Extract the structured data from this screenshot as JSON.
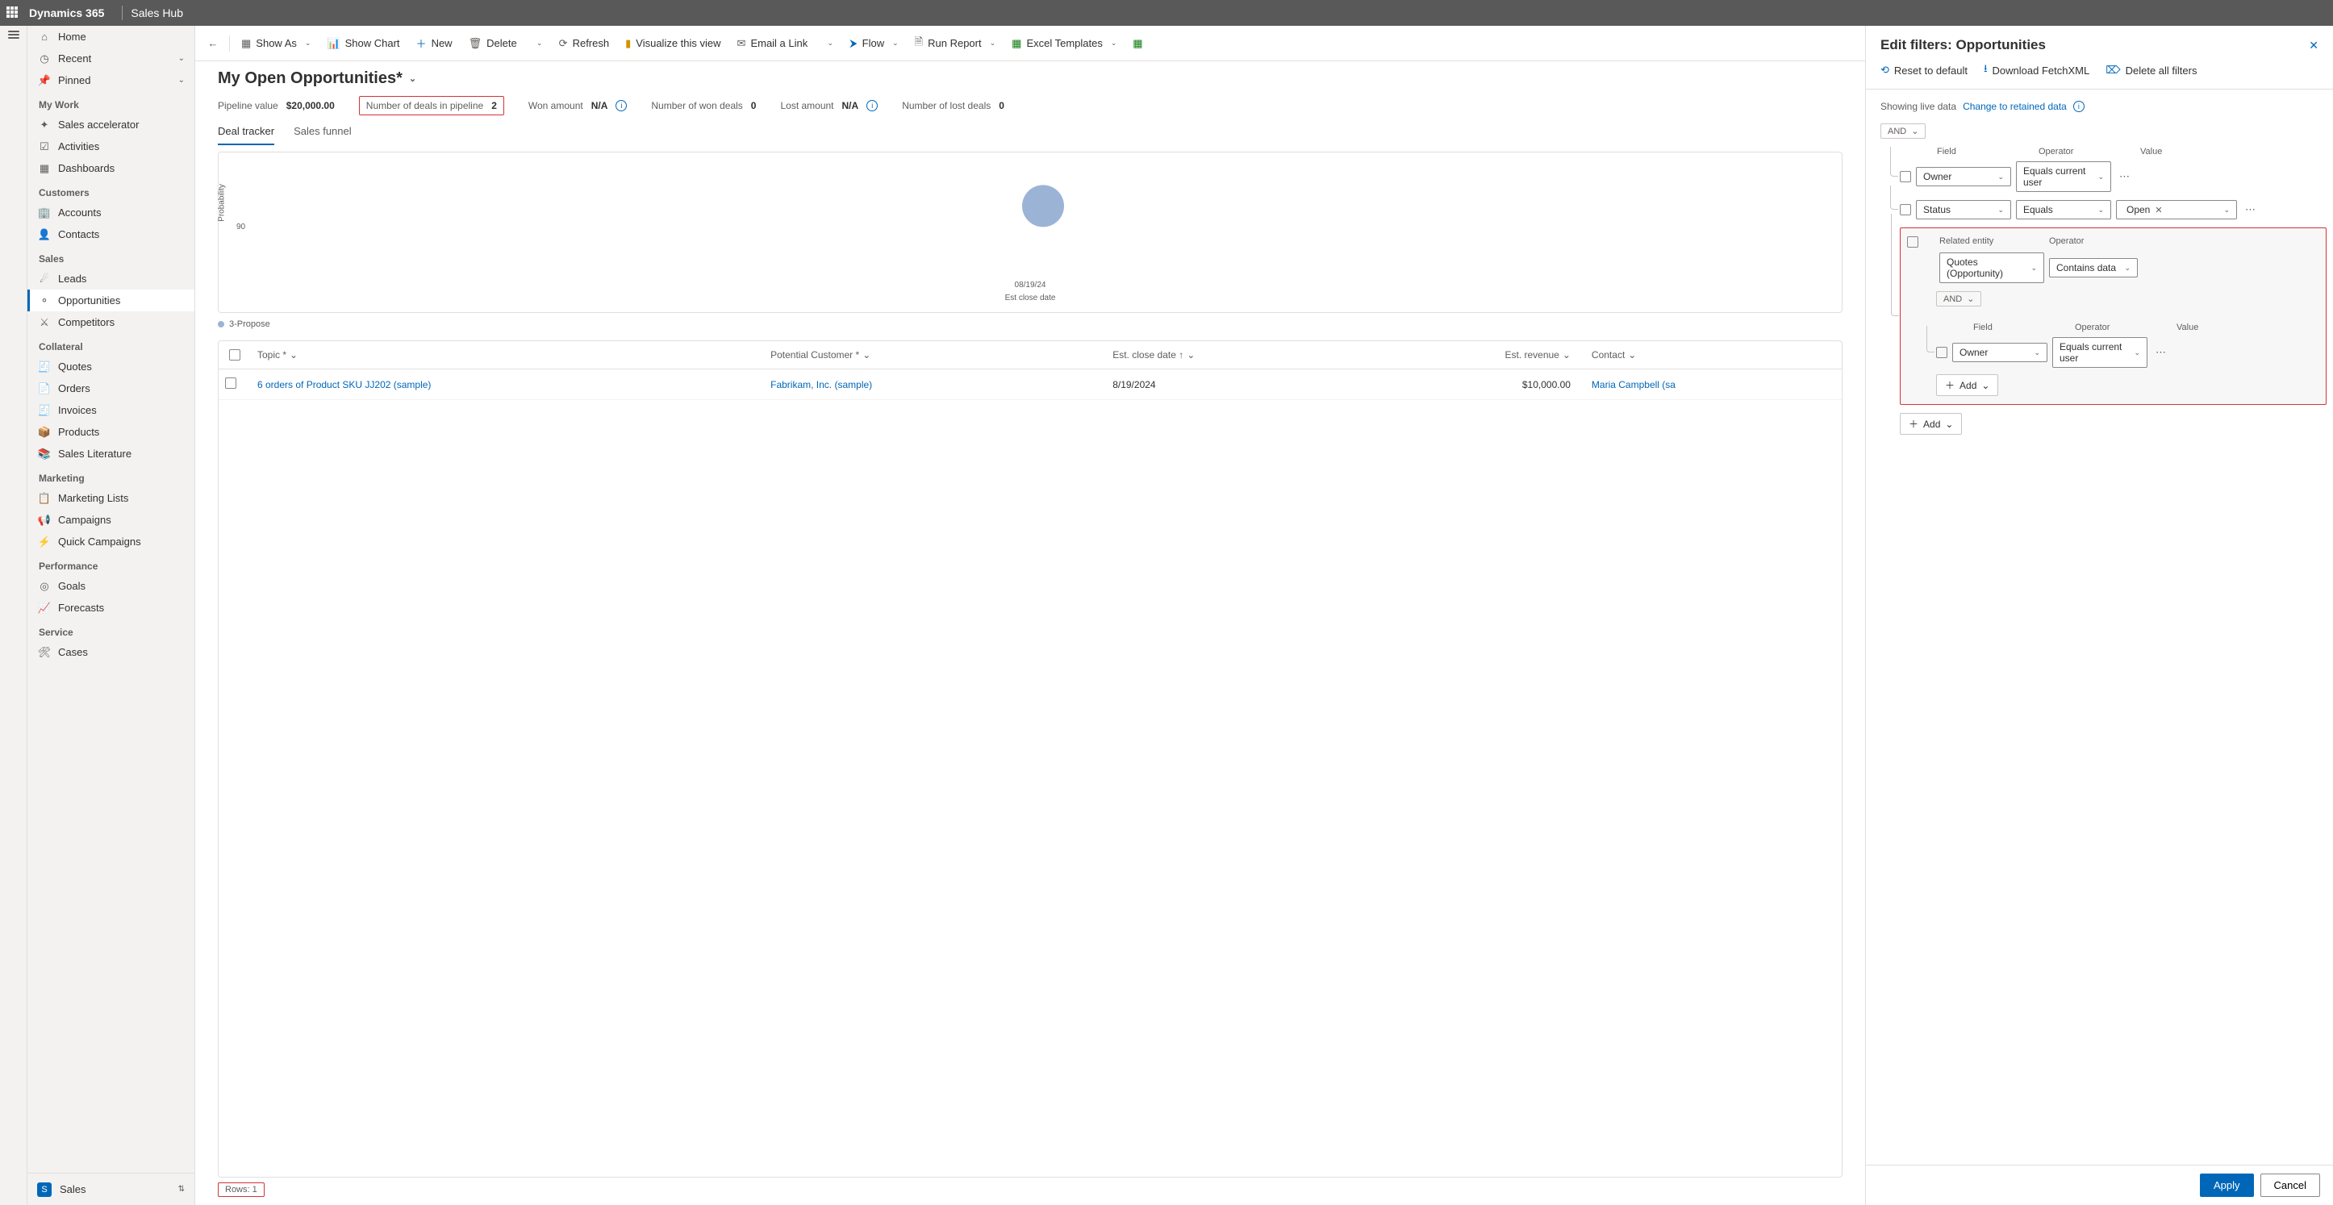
{
  "topbar": {
    "product": "Dynamics 365",
    "app": "Sales Hub"
  },
  "sidebar": {
    "home": "Home",
    "recent": "Recent",
    "pinned": "Pinned",
    "sec_mywork": "My Work",
    "sales_accel": "Sales accelerator",
    "activities": "Activities",
    "dashboards": "Dashboards",
    "sec_customers": "Customers",
    "accounts": "Accounts",
    "contacts": "Contacts",
    "sec_sales": "Sales",
    "leads": "Leads",
    "opportunities": "Opportunities",
    "competitors": "Competitors",
    "sec_collateral": "Collateral",
    "quotes": "Quotes",
    "orders": "Orders",
    "invoices": "Invoices",
    "products": "Products",
    "saleslit": "Sales Literature",
    "sec_marketing": "Marketing",
    "mktlists": "Marketing Lists",
    "campaigns": "Campaigns",
    "quickcamp": "Quick Campaigns",
    "sec_performance": "Performance",
    "goals": "Goals",
    "forecasts": "Forecasts",
    "sec_service": "Service",
    "cases": "Cases",
    "area": "Sales"
  },
  "cmd": {
    "showas": "Show As",
    "showchart": "Show Chart",
    "new": "New",
    "delete": "Delete",
    "refresh": "Refresh",
    "visualize": "Visualize this view",
    "emaillink": "Email a Link",
    "flow": "Flow",
    "runreport": "Run Report",
    "excel": "Excel Templates"
  },
  "view": {
    "title": "My Open Opportunities*"
  },
  "metrics": {
    "pipeline_l": "Pipeline value",
    "pipeline_v": "$20,000.00",
    "deals_l": "Number of deals in pipeline",
    "deals_v": "2",
    "won_l": "Won amount",
    "won_v": "N/A",
    "wondeals_l": "Number of won deals",
    "wondeals_v": "0",
    "lost_l": "Lost amount",
    "lost_v": "N/A",
    "lostdeals_l": "Number of lost deals",
    "lostdeals_v": "0"
  },
  "tabs": {
    "deal": "Deal tracker",
    "funnel": "Sales funnel"
  },
  "chart": {
    "ylabel": "Probability",
    "ytick": "90",
    "xtick": "08/19/24",
    "xlabel": "Est close date",
    "legend": "3-Propose"
  },
  "grid": {
    "h_topic": "Topic *",
    "h_cust": "Potential Customer *",
    "h_close": "Est. close date ↑",
    "h_rev": "Est. revenue",
    "h_contact": "Contact",
    "r1_topic": "6 orders of Product SKU JJ202 (sample)",
    "r1_cust": "Fabrikam, Inc. (sample)",
    "r1_close": "8/19/2024",
    "r1_rev": "$10,000.00",
    "r1_contact": "Maria Campbell (sa"
  },
  "footer": {
    "rows": "Rows: 1"
  },
  "panel": {
    "title": "Edit filters: Opportunities",
    "reset": "Reset to default",
    "download": "Download FetchXML",
    "deleteall": "Delete all filters",
    "live": "Showing live data",
    "change": "Change to retained data",
    "and": "AND",
    "hdr_field": "Field",
    "hdr_op": "Operator",
    "hdr_val": "Value",
    "r1_field": "Owner",
    "r1_op": "Equals current user",
    "r2_field": "Status",
    "r2_op": "Equals",
    "r2_val": "Open",
    "rel_label": "Related entity",
    "rel_entity": "Quotes (Opportunity)",
    "rel_op": "Contains data",
    "sub_field": "Owner",
    "sub_op": "Equals current user",
    "add": "Add",
    "apply": "Apply",
    "cancel": "Cancel"
  },
  "chart_data": {
    "type": "scatter",
    "title": "",
    "xlabel": "Est close date",
    "ylabel": "Probability",
    "series": [
      {
        "name": "3-Propose",
        "points": [
          {
            "x": "08/19/24",
            "y": 90
          }
        ]
      }
    ],
    "ylim": [
      0,
      100
    ]
  }
}
